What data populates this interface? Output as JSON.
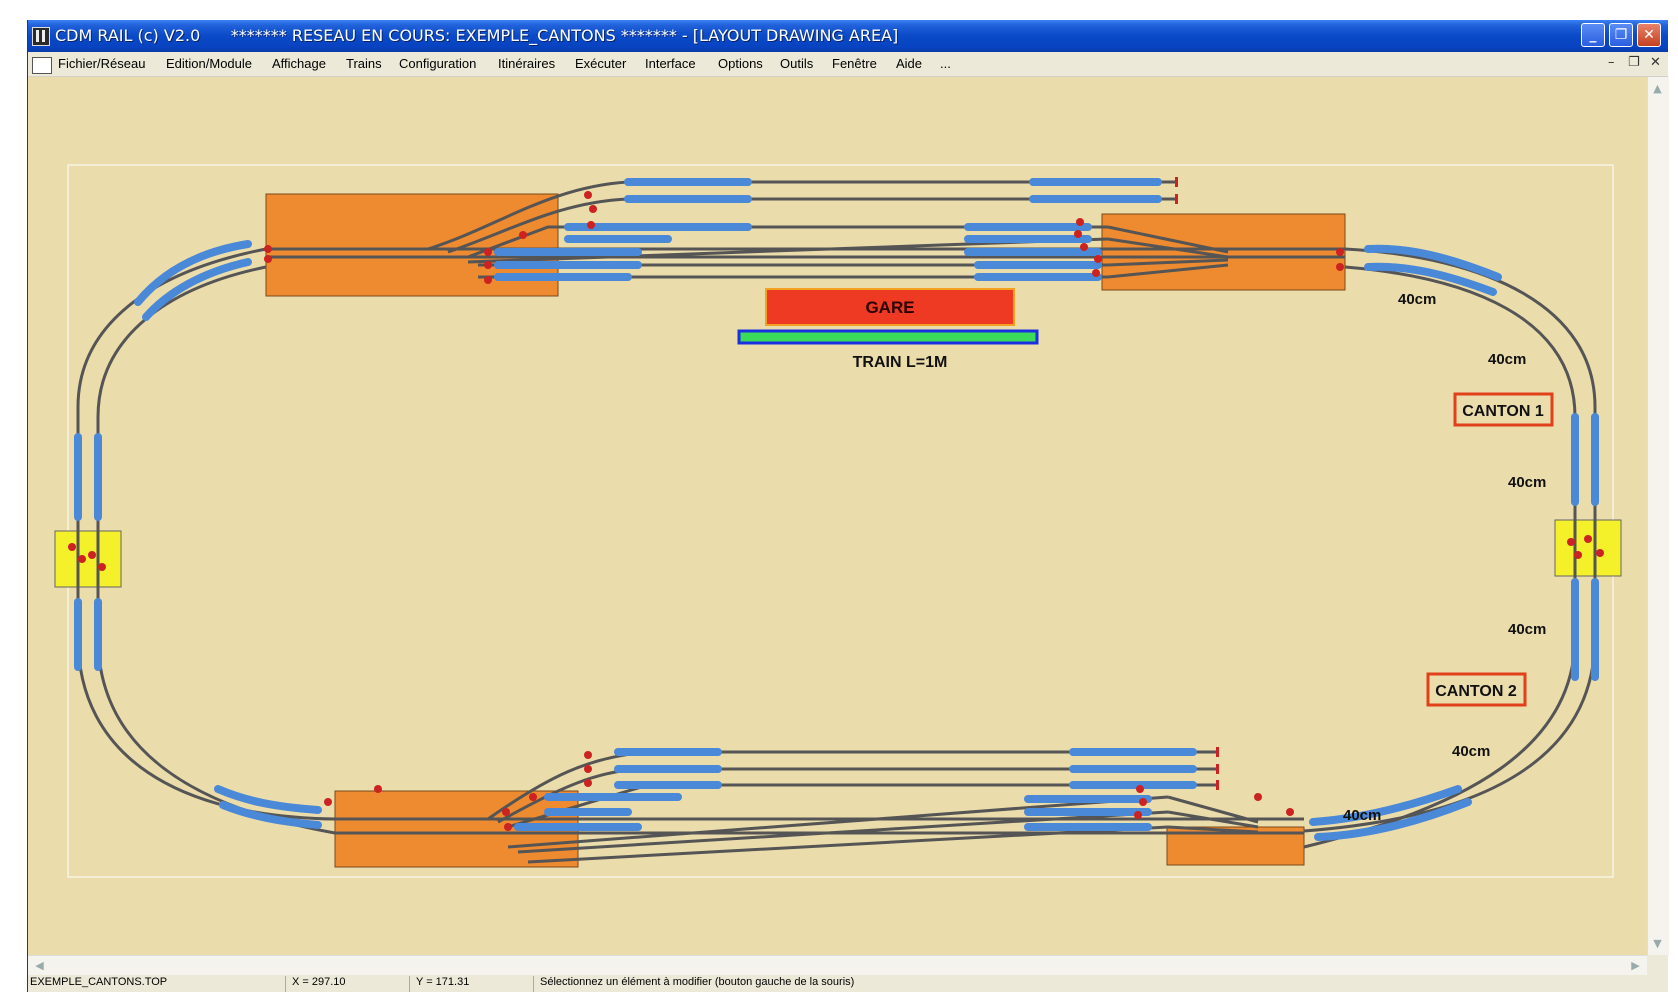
{
  "window": {
    "title": "CDM RAIL (c) V2.0      ******* RESEAU EN COURS: EXEMPLE_CANTONS ******* - [LAYOUT DRAWING AREA]",
    "minimize_glyph": "_",
    "restore_glyph": "❐",
    "close_glyph": "✕"
  },
  "menu": {
    "items": [
      "Fichier/Réseau",
      "Edition/Module",
      "Affichage",
      "Trains",
      "Configuration",
      "Itinéraires",
      "Exécuter",
      "Interface",
      "Options",
      "Outils",
      "Fenêtre",
      "Aide",
      "..."
    ],
    "mdi_minimize": "–",
    "mdi_restore": "❐",
    "mdi_close": "✕"
  },
  "layout": {
    "station_label": "GARE",
    "train_label": "TRAIN L=1M",
    "canton_labels": [
      "CANTON 1",
      "CANTON 2"
    ],
    "segment_labels": [
      "40cm",
      "40cm",
      "40cm",
      "40cm",
      "40cm",
      "40cm"
    ],
    "colors": {
      "background": "#EBDCAC",
      "platform": "#EE8A30",
      "station": "#EE3A22",
      "track_section": "#4A88D8",
      "rail": "#555555",
      "module": "#F4F02A",
      "canton_border": "#E0401A"
    }
  },
  "status": {
    "file": "EXEMPLE_CANTONS.TOP",
    "x": "X =   297.10",
    "y": "Y =   171.31",
    "message": "Sélectionnez un élément à modifier (bouton gauche de la souris)"
  }
}
